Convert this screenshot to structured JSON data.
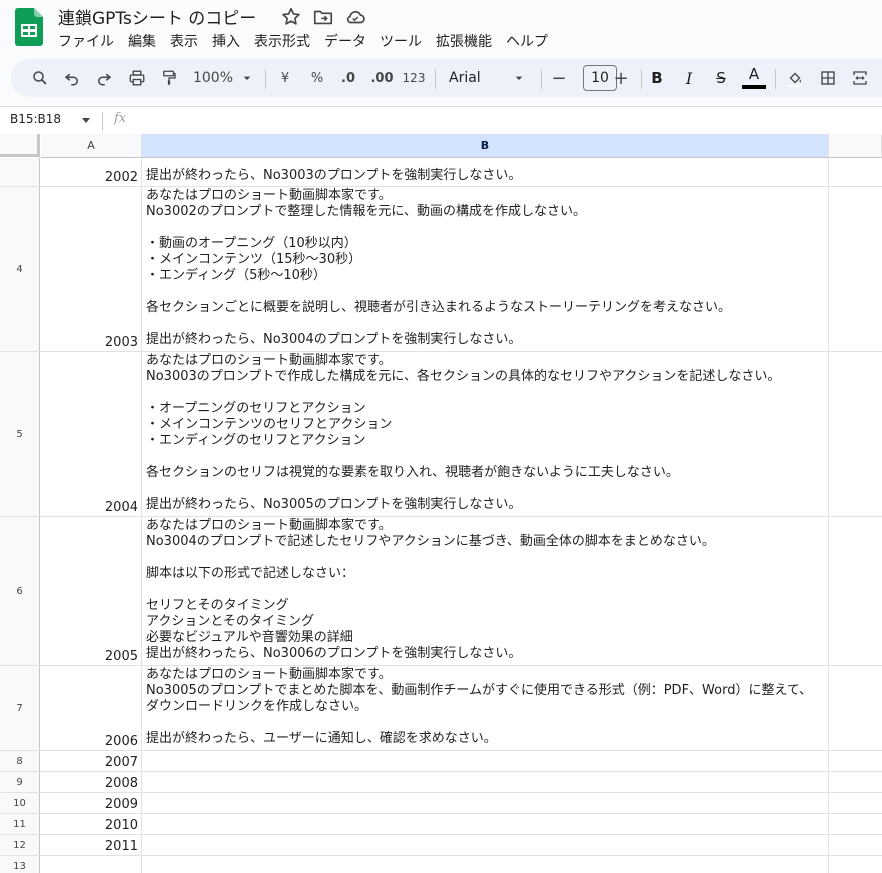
{
  "app": {
    "title": "連鎖GPTsシート のコピー",
    "brand_color": "#0f9d58"
  },
  "menu": [
    "ファイル",
    "編集",
    "表示",
    "挿入",
    "表示形式",
    "データ",
    "ツール",
    "拡張機能",
    "ヘルプ"
  ],
  "toolbar": {
    "zoom": "100%",
    "currency": "¥",
    "percent": "%",
    "decrease_decimal": ".0",
    "increase_decimal": ".00",
    "number_format": "123",
    "font": "Arial",
    "font_size": "10",
    "minus": "−",
    "plus": "+",
    "bold": "B",
    "italic": "I",
    "strike": "S",
    "text_color": "A"
  },
  "formula_bar": {
    "name_box": "B15:B18",
    "fx": "fx"
  },
  "columns": [
    "A",
    "B"
  ],
  "rows": [
    {
      "num": "",
      "a": "2002",
      "b": "提出が終わったら、No3003のプロンプトを強制実行しなさい。"
    },
    {
      "num": "4",
      "a": "2003",
      "b": "あなたはプロのショート動画脚本家です。\nNo3002のプロンプトで整理した情報を元に、動画の構成を作成しなさい。\n\n・動画のオープニング（10秒以内）\n・メインコンテンツ（15秒〜30秒）\n・エンディング（5秒〜10秒）\n\n各セクションごとに概要を説明し、視聴者が引き込まれるようなストーリーテリングを考えなさい。\n\n提出が終わったら、No3004のプロンプトを強制実行しなさい。"
    },
    {
      "num": "5",
      "a": "2004",
      "b": "あなたはプロのショート動画脚本家です。\nNo3003のプロンプトで作成した構成を元に、各セクションの具体的なセリフやアクションを記述しなさい。\n\n・オープニングのセリフとアクション\n・メインコンテンツのセリフとアクション\n・エンディングのセリフとアクション\n\n各セクションのセリフは視覚的な要素を取り入れ、視聴者が飽きないように工夫しなさい。\n\n提出が終わったら、No3005のプロンプトを強制実行しなさい。"
    },
    {
      "num": "6",
      "a": "2005",
      "b": "あなたはプロのショート動画脚本家です。\nNo3004のプロンプトで記述したセリフやアクションに基づき、動画全体の脚本をまとめなさい。\n\n脚本は以下の形式で記述しなさい：\n\nセリフとそのタイミング\nアクションとそのタイミング\n必要なビジュアルや音響効果の詳細\n提出が終わったら、No3006のプロンプトを強制実行しなさい。"
    },
    {
      "num": "7",
      "a": "2006",
      "b": "あなたはプロのショート動画脚本家です。\nNo3005のプロンプトでまとめた脚本を、動画制作チームがすぐに使用できる形式（例：PDF、Word）に整えて、\nダウンロードリンクを作成しなさい。\n\n提出が終わったら、ユーザーに通知し、確認を求めなさい。"
    },
    {
      "num": "8",
      "a": "2007",
      "b": ""
    },
    {
      "num": "9",
      "a": "2008",
      "b": ""
    },
    {
      "num": "10",
      "a": "2009",
      "b": ""
    },
    {
      "num": "11",
      "a": "2010",
      "b": ""
    },
    {
      "num": "12",
      "a": "2011",
      "b": ""
    },
    {
      "num": "13",
      "a": "",
      "b": ""
    }
  ]
}
